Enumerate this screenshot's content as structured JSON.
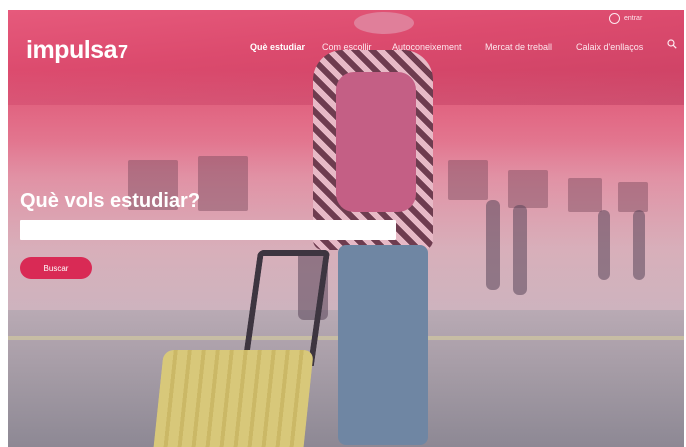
{
  "header": {
    "logo_text": "impulsa",
    "nav": [
      {
        "label": "Què estudiar",
        "active": true
      },
      {
        "label": "Com escollir",
        "active": false
      },
      {
        "label": "Autoconeixement",
        "active": false
      },
      {
        "label": "Mercat de treball",
        "active": false
      },
      {
        "label": "Calaix d'enllaços",
        "active": false
      }
    ],
    "user_link": "entrar",
    "search_icon": "search-icon",
    "user_icon": "user-icon"
  },
  "hero": {
    "title": "Què vols estudiar?",
    "input_value": "",
    "button_label": "Buscar"
  },
  "colors": {
    "accent": "#d92a55",
    "overlay": "#e24a6c"
  }
}
